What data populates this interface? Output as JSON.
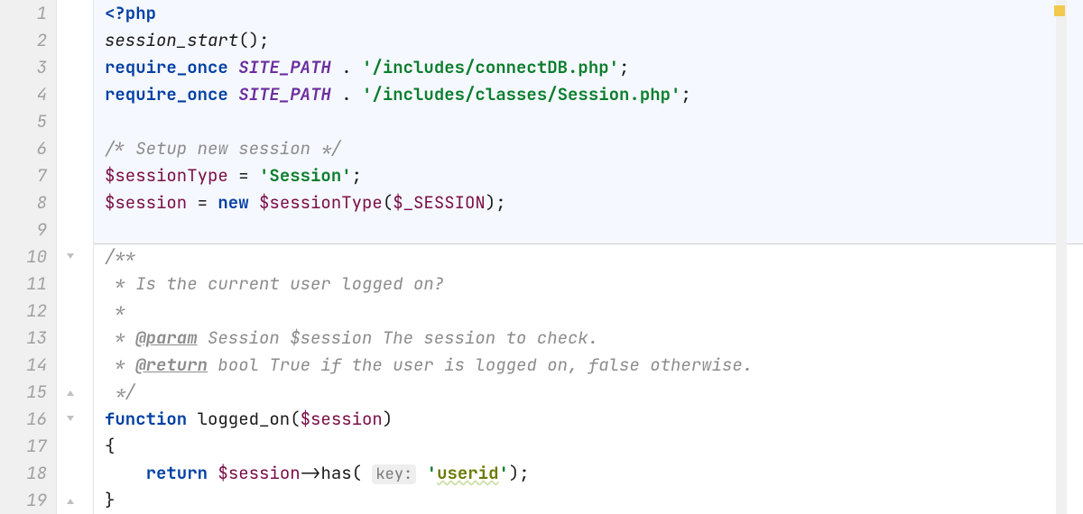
{
  "gutter": {
    "lines": [
      "1",
      "2",
      "3",
      "4",
      "5",
      "6",
      "7",
      "8",
      "9",
      "10",
      "11",
      "12",
      "13",
      "14",
      "15",
      "16",
      "17",
      "18",
      "19"
    ]
  },
  "status": {
    "color": "#f2c94c"
  },
  "code": {
    "l1": {
      "php_open": "<?php"
    },
    "l2": {
      "fn": "session_start",
      "paren": "();"
    },
    "l3": {
      "kw": "require_once",
      "const": "SITE_PATH",
      "dot": " . ",
      "str": "'/includes/connectDB.php'",
      "semi": ";"
    },
    "l4": {
      "kw": "require_once",
      "const": "SITE_PATH",
      "dot": " . ",
      "str": "'/includes/classes/Session.php'",
      "semi": ";"
    },
    "l6": {
      "comment": "/* Setup new session */"
    },
    "l7": {
      "var": "$sessionType",
      "eq": " = ",
      "str": "'Session'",
      "semi": ";"
    },
    "l8": {
      "var1": "$session",
      "eq": " = ",
      "kw": "new",
      "sp": " ",
      "var2": "$sessionType",
      "open": "(",
      "arg": "$_SESSION",
      "close": ");"
    },
    "l10": {
      "doc": "/**"
    },
    "l11": {
      "doc": " * Is the current user logged on?"
    },
    "l12": {
      "doc": " *"
    },
    "l13": {
      "pre": " * ",
      "tag": "@param",
      "rest": " Session $session The session to check."
    },
    "l14": {
      "pre": " * ",
      "tag": "@return",
      "rest": " bool True if the user is logged on, false otherwise."
    },
    "l15": {
      "doc": " */"
    },
    "l16": {
      "kw": "function",
      "sp": " ",
      "name": "logged_on",
      "open": "(",
      "arg": "$session",
      "close": ")"
    },
    "l17": {
      "brace": "{"
    },
    "l18": {
      "indent": "    ",
      "kw": "return",
      "sp": " ",
      "var": "$session",
      "arrow": "->",
      "method": "has",
      "open": "( ",
      "hint": "key:",
      "sp2": " ",
      "str": "'",
      "key": "userid",
      "strend": "'",
      "close": ");"
    },
    "l19": {
      "brace": "}"
    }
  }
}
